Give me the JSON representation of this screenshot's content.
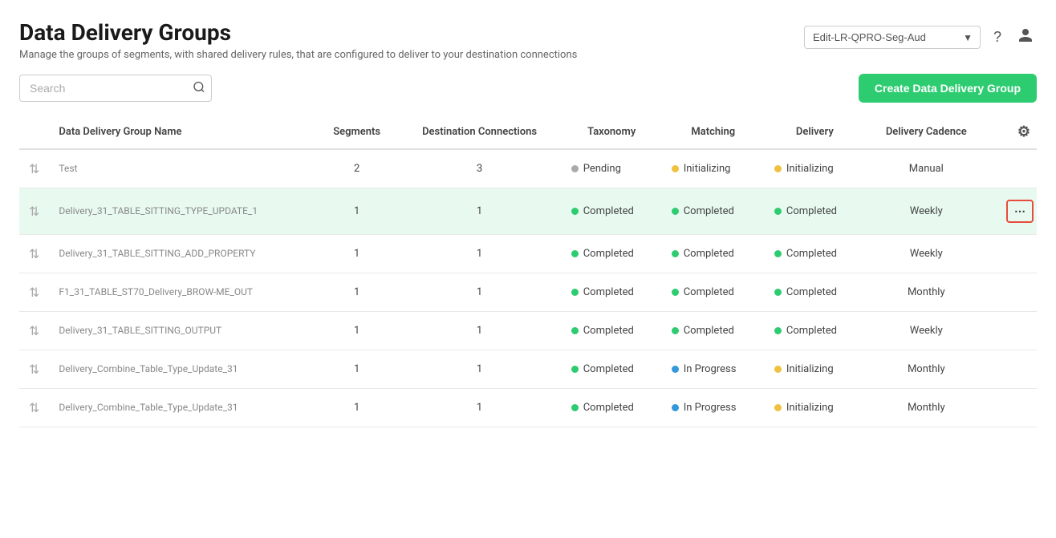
{
  "page": {
    "title": "Data Delivery Groups",
    "subtitle": "Manage the groups of segments, with shared delivery rules, that are configured to deliver to your destination connections"
  },
  "header": {
    "dropdown_placeholder": "Edit-LR-QPRO-Seg-Aud",
    "help_icon": "?",
    "user_icon": "person"
  },
  "toolbar": {
    "search_placeholder": "Search",
    "create_button_label": "Create Data Delivery Group"
  },
  "table": {
    "columns": [
      {
        "key": "name",
        "label": "Data Delivery Group Name"
      },
      {
        "key": "segments",
        "label": "Segments"
      },
      {
        "key": "destination_connections",
        "label": "Destination Connections"
      },
      {
        "key": "taxonomy",
        "label": "Taxonomy"
      },
      {
        "key": "matching",
        "label": "Matching"
      },
      {
        "key": "delivery",
        "label": "Delivery"
      },
      {
        "key": "delivery_cadence",
        "label": "Delivery Cadence"
      }
    ],
    "rows": [
      {
        "id": 1,
        "name": "Test",
        "segments": 2,
        "destination_connections": 3,
        "taxonomy": "Pending",
        "taxonomy_dot": "gray",
        "matching": "Initializing",
        "matching_dot": "yellow",
        "delivery": "Initializing",
        "delivery_dot": "yellow",
        "delivery_cadence": "Manual",
        "highlighted": false,
        "show_action": false
      },
      {
        "id": 2,
        "name": "Delivery_31_TABLE_SITTING_TYPE_UPDATE_1",
        "segments": 1,
        "destination_connections": 1,
        "taxonomy": "Completed",
        "taxonomy_dot": "green",
        "matching": "Completed",
        "matching_dot": "green",
        "delivery": "Completed",
        "delivery_dot": "green",
        "delivery_cadence": "Weekly",
        "highlighted": true,
        "show_action": true
      },
      {
        "id": 3,
        "name": "Delivery_31_TABLE_SITTING_ADD_PROPERTY",
        "segments": 1,
        "destination_connections": 1,
        "taxonomy": "Completed",
        "taxonomy_dot": "green",
        "matching": "Completed",
        "matching_dot": "green",
        "delivery": "Completed",
        "delivery_dot": "green",
        "delivery_cadence": "Weekly",
        "highlighted": false,
        "show_action": false
      },
      {
        "id": 4,
        "name": "F1_31_TABLE_ST70_Delivery_BROW-ME_OUT",
        "segments": 1,
        "destination_connections": 1,
        "taxonomy": "Completed",
        "taxonomy_dot": "green",
        "matching": "Completed",
        "matching_dot": "green",
        "delivery": "Completed",
        "delivery_dot": "green",
        "delivery_cadence": "Monthly",
        "highlighted": false,
        "show_action": false
      },
      {
        "id": 5,
        "name": "Delivery_31_TABLE_SITTING_OUTPUT",
        "segments": 1,
        "destination_connections": 1,
        "taxonomy": "Completed",
        "taxonomy_dot": "green",
        "matching": "Completed",
        "matching_dot": "green",
        "delivery": "Completed",
        "delivery_dot": "green",
        "delivery_cadence": "Weekly",
        "highlighted": false,
        "show_action": false
      },
      {
        "id": 6,
        "name": "Delivery_Combine_Table_Type_Update_31",
        "segments": 1,
        "destination_connections": 1,
        "taxonomy": "Completed",
        "taxonomy_dot": "green",
        "matching": "In Progress",
        "matching_dot": "blue",
        "delivery": "Initializing",
        "delivery_dot": "yellow",
        "delivery_cadence": "Monthly",
        "highlighted": false,
        "show_action": false
      },
      {
        "id": 7,
        "name": "Delivery_Combine_Table_Type_Update_31",
        "segments": 1,
        "destination_connections": 1,
        "taxonomy": "Completed",
        "taxonomy_dot": "green",
        "matching": "In Progress",
        "matching_dot": "blue",
        "delivery": "Initializing",
        "delivery_dot": "yellow",
        "delivery_cadence": "Monthly",
        "highlighted": false,
        "show_action": false
      }
    ]
  }
}
